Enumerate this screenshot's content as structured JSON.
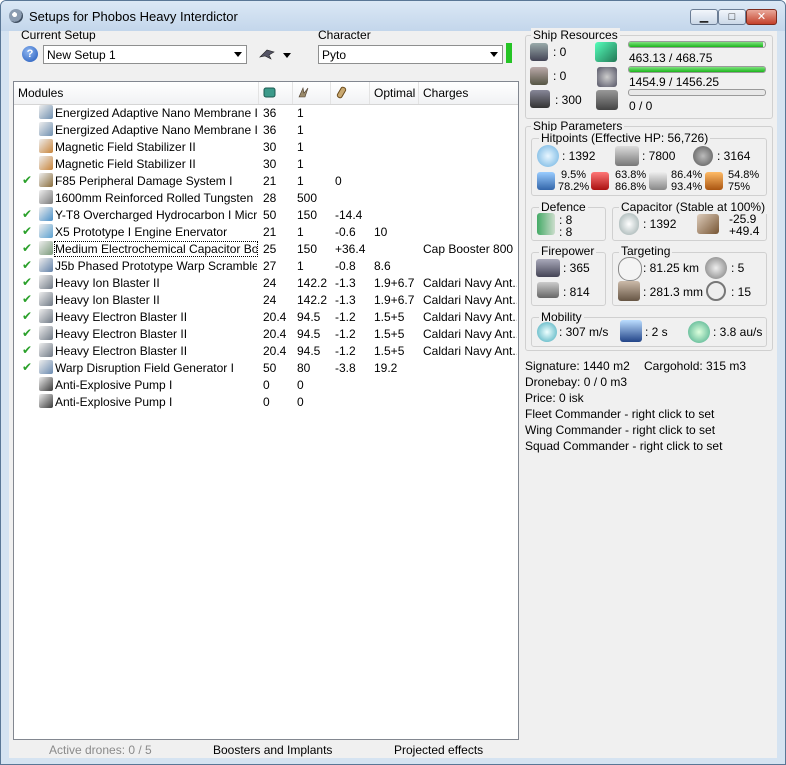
{
  "window": {
    "title": "Setups for Phobos Heavy Interdictor",
    "buttons": {
      "minimize": "▁",
      "maximize": "□",
      "close": "✕"
    }
  },
  "setup": {
    "current_setup_label": "Current Setup",
    "current_setup_value": "New Setup 1",
    "help_glyph": "?",
    "character_label": "Character",
    "character_value": "Pyto"
  },
  "modules": {
    "headers": {
      "name": "Modules",
      "col1_icon": "cpu-icon",
      "col2_icon": "powergrid-icon",
      "col3_icon": "capacitor-use-icon",
      "optimal": "Optimal",
      "charges": "Charges"
    },
    "rows": [
      {
        "checked": false,
        "name": "Energized Adaptive Nano Membrane II",
        "cpu": "36",
        "pg": "1",
        "cap": "",
        "optimal": "",
        "charges": "",
        "icon_color": "#6f8fb0"
      },
      {
        "checked": false,
        "name": "Energized Adaptive Nano Membrane II",
        "cpu": "36",
        "pg": "1",
        "cap": "",
        "optimal": "",
        "charges": "",
        "icon_color": "#6f8fb0"
      },
      {
        "checked": false,
        "name": "Magnetic Field Stabilizer II",
        "cpu": "30",
        "pg": "1",
        "cap": "",
        "optimal": "",
        "charges": "",
        "icon_color": "#c8843a"
      },
      {
        "checked": false,
        "name": "Magnetic Field Stabilizer II",
        "cpu": "30",
        "pg": "1",
        "cap": "",
        "optimal": "",
        "charges": "",
        "icon_color": "#c8843a"
      },
      {
        "checked": true,
        "name": "F85 Peripheral Damage System I",
        "cpu": "21",
        "pg": "1",
        "cap": "0",
        "optimal": "",
        "charges": "",
        "icon_color": "#8a6d3b"
      },
      {
        "checked": false,
        "name": "1600mm Reinforced Rolled Tungsten Pl...",
        "cpu": "28",
        "pg": "500",
        "cap": "",
        "optimal": "",
        "charges": "",
        "icon_color": "#7a7a7a"
      },
      {
        "checked": true,
        "name": "Y-T8 Overcharged Hydrocarbon I Micro...",
        "cpu": "50",
        "pg": "150",
        "cap": "-14.4",
        "optimal": "",
        "charges": "",
        "icon_color": "#4a90c8"
      },
      {
        "checked": true,
        "name": "X5 Prototype I Engine Enervator",
        "cpu": "21",
        "pg": "1",
        "cap": "-0.6",
        "optimal": "10",
        "charges": "",
        "icon_color": "#5aa0d0"
      },
      {
        "checked": true,
        "name": "Medium Electrochemical Capacitor Boos...",
        "cpu": "25",
        "pg": "150",
        "cap": "+36.4",
        "optimal": "",
        "charges": "Cap Booster 800",
        "icon_color": "#7a9a7a",
        "selected": true
      },
      {
        "checked": true,
        "name": "J5b Phased Prototype Warp Scrambler I",
        "cpu": "27",
        "pg": "1",
        "cap": "-0.8",
        "optimal": "8.6",
        "charges": "",
        "icon_color": "#6080a8"
      },
      {
        "checked": true,
        "name": "Heavy Ion Blaster II",
        "cpu": "24",
        "pg": "142.2",
        "cap": "-1.3",
        "optimal": "1.9+6.7",
        "charges": "Caldari Navy Ant...",
        "icon_color": "#707a86"
      },
      {
        "checked": true,
        "name": "Heavy Ion Blaster II",
        "cpu": "24",
        "pg": "142.2",
        "cap": "-1.3",
        "optimal": "1.9+6.7",
        "charges": "Caldari Navy Ant...",
        "icon_color": "#707a86"
      },
      {
        "checked": true,
        "name": "Heavy Electron Blaster II",
        "cpu": "20.4",
        "pg": "94.5",
        "cap": "-1.2",
        "optimal": "1.5+5",
        "charges": "Caldari Navy Ant...",
        "icon_color": "#707a86"
      },
      {
        "checked": true,
        "name": "Heavy Electron Blaster II",
        "cpu": "20.4",
        "pg": "94.5",
        "cap": "-1.2",
        "optimal": "1.5+5",
        "charges": "Caldari Navy Ant...",
        "icon_color": "#707a86"
      },
      {
        "checked": true,
        "name": "Heavy Electron Blaster II",
        "cpu": "20.4",
        "pg": "94.5",
        "cap": "-1.2",
        "optimal": "1.5+5",
        "charges": "Caldari Navy Ant...",
        "icon_color": "#707a86"
      },
      {
        "checked": true,
        "name": "Warp Disruption Field Generator I",
        "cpu": "50",
        "pg": "80",
        "cap": "-3.8",
        "optimal": "19.2",
        "charges": "",
        "icon_color": "#6a8ab0"
      },
      {
        "checked": false,
        "name": "Anti-Explosive Pump I",
        "cpu": "0",
        "pg": "0",
        "cap": "",
        "optimal": "",
        "charges": "",
        "icon_color": "#3a3a3a"
      },
      {
        "checked": false,
        "name": "Anti-Explosive Pump I",
        "cpu": "0",
        "pg": "0",
        "cap": "",
        "optimal": "",
        "charges": "",
        "icon_color": "#3a3a3a"
      }
    ]
  },
  "bottom": {
    "active_drones": "Active drones: 0 / 5",
    "boosters": "Boosters and Implants",
    "projected": "Projected effects"
  },
  "resources": {
    "title": "Ship Resources",
    "turrets": ": 0",
    "launchers": ": 0",
    "calibration": ": 300",
    "cpu_text": "463.13 / 468.75",
    "cpu_fraction": 0.988,
    "pg_text": "1454.9 / 1456.25",
    "pg_fraction": 0.999,
    "drone_bw_text": "0 / 0",
    "drone_bw_fraction": 0
  },
  "params": {
    "title": "Ship Parameters",
    "hitpoints_title": "Hitpoints (Effective HP: 56,726)",
    "shield_hp": ": 1392",
    "armor_hp": ": 7800",
    "hull_hp": ": 3164",
    "res_em_1": "9.5%",
    "res_em_2": "78.2%",
    "res_th_1": "63.8%",
    "res_th_2": "86.8%",
    "res_ki_1": "86.4%",
    "res_ki_2": "93.4%",
    "res_ex_1": "54.8%",
    "res_ex_2": "75%",
    "defence_title": "Defence",
    "defence_a": ": 8",
    "defence_b": ": 8",
    "capacitor_title": "Capacitor (Stable at 100%)",
    "cap_amount": ": 1392",
    "cap_delta_1": "-25.9",
    "cap_delta_2": "+49.4",
    "firepower_title": "Firepower",
    "fp_turret": ": 365",
    "fp_volley": ": 814",
    "targeting_title": "Targeting",
    "range": ": 81.25 km",
    "max_targets": ": 5",
    "scan_res": ": 281.3 mm",
    "sensor": ": 15",
    "mobility_title": "Mobility",
    "speed": ": 307 m/s",
    "align": ": 2 s",
    "warp": ": 3.8 au/s"
  },
  "info": {
    "signature": "Signature: 1440 m2",
    "cargohold": "Cargohold: 315 m3",
    "dronebay": "Dronebay: 0 / 0 m3",
    "price": "Price: 0 isk",
    "fleet": "Fleet Commander - right click to set",
    "wing": "Wing Commander - right click to set",
    "squad": "Squad Commander - right click to set"
  }
}
